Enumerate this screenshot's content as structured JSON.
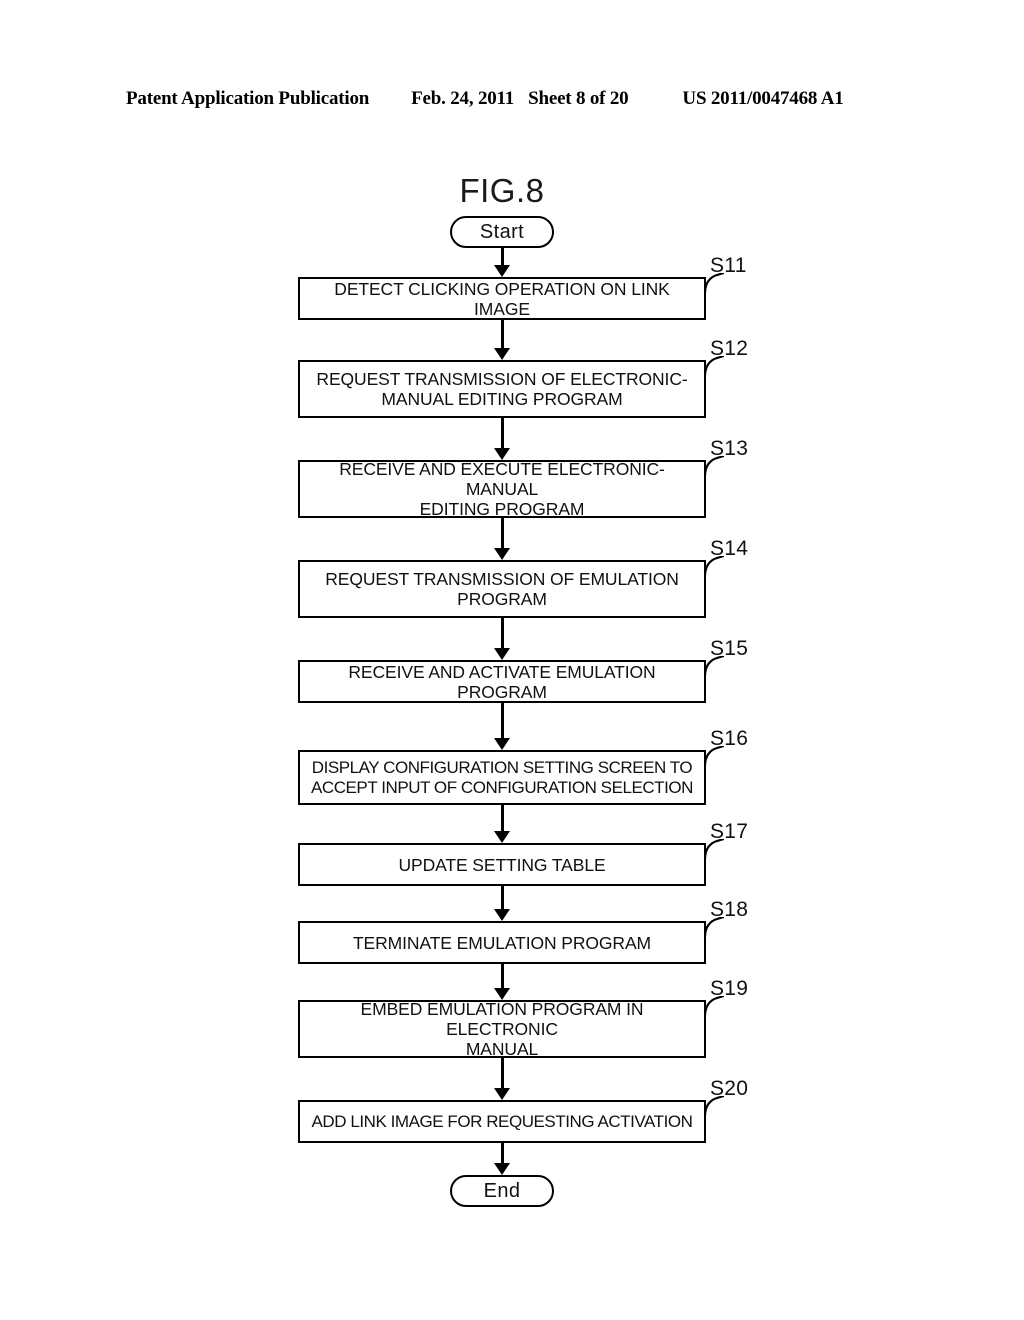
{
  "header": {
    "publication": "Patent Application Publication",
    "date": "Feb. 24, 2011",
    "sheet": "Sheet 8 of 20",
    "number": "US 2011/0047468 A1"
  },
  "figure": {
    "title": "FIG.8",
    "start_label": "Start",
    "end_label": "End"
  },
  "flowchart": {
    "type": "flowchart",
    "orientation": "vertical",
    "steps": [
      {
        "id": "S11",
        "text": "DETECT CLICKING OPERATION ON LINK IMAGE",
        "lines": [
          "DETECT CLICKING OPERATION ON LINK IMAGE"
        ]
      },
      {
        "id": "S12",
        "text": "REQUEST TRANSMISSION OF ELECTRONIC-MANUAL EDITING PROGRAM",
        "lines": [
          "REQUEST TRANSMISSION OF ELECTRONIC-",
          "MANUAL EDITING PROGRAM"
        ]
      },
      {
        "id": "S13",
        "text": "RECEIVE AND EXECUTE ELECTRONIC-MANUAL EDITING PROGRAM",
        "lines": [
          "RECEIVE AND EXECUTE ELECTRONIC-MANUAL",
          "EDITING PROGRAM"
        ]
      },
      {
        "id": "S14",
        "text": "REQUEST TRANSMISSION OF EMULATION PROGRAM",
        "lines": [
          "REQUEST TRANSMISSION OF EMULATION",
          "PROGRAM"
        ]
      },
      {
        "id": "S15",
        "text": "RECEIVE AND ACTIVATE EMULATION PROGRAM",
        "lines": [
          "RECEIVE AND ACTIVATE EMULATION PROGRAM"
        ]
      },
      {
        "id": "S16",
        "text": "DISPLAY CONFIGURATION SETTING SCREEN TO ACCEPT INPUT OF CONFIGURATION SELECTION",
        "lines": [
          "DISPLAY CONFIGURATION SETTING SCREEN TO",
          "ACCEPT INPUT OF CONFIGURATION SELECTION"
        ]
      },
      {
        "id": "S17",
        "text": "UPDATE SETTING TABLE",
        "lines": [
          "UPDATE SETTING TABLE"
        ]
      },
      {
        "id": "S18",
        "text": "TERMINATE EMULATION PROGRAM",
        "lines": [
          "TERMINATE EMULATION PROGRAM"
        ]
      },
      {
        "id": "S19",
        "text": "EMBED EMULATION PROGRAM IN ELECTRONIC MANUAL",
        "lines": [
          "EMBED EMULATION PROGRAM IN ELECTRONIC",
          "MANUAL"
        ]
      },
      {
        "id": "S20",
        "text": "ADD LINK IMAGE FOR REQUESTING ACTIVATION",
        "lines": [
          "ADD LINK IMAGE FOR REQUESTING ACTIVATION"
        ]
      }
    ]
  },
  "colors": {
    "ink": "#000000",
    "paper": "#ffffff"
  }
}
